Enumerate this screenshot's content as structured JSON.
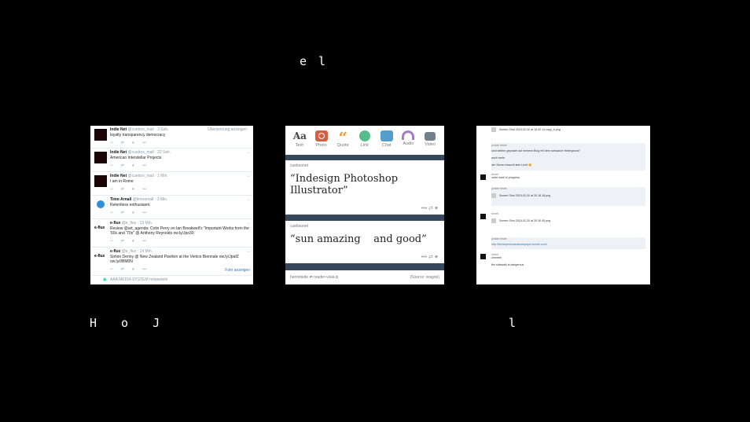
{
  "overlay": {
    "top": "e l",
    "bottom_left": "H o J",
    "bottom_right": "l"
  },
  "twitter": {
    "follow_label": "Übersetzung anzeigen",
    "actions": "↩ ⇄ ★ •••",
    "tweets": [
      {
        "name": "Indie Net",
        "handle": "@cuebox_mail · 3 Sek.",
        "text": "loyalty transparency democracy"
      },
      {
        "name": "Indie Net",
        "handle": "@cuebox_mail · 22 Sek.",
        "text": "American Interstellar Projects"
      },
      {
        "name": "Indie Net",
        "handle": "@cuebox_mail · 1 Min.",
        "text": "I am in Rome"
      },
      {
        "name": "Timo Arnall",
        "handle": "@timoarnall · 3 Min.",
        "text": "Relentless enthusiasm."
      },
      {
        "name": "e-flux",
        "handle": "@e_flux · 13 Min.",
        "text": "Review @art_agenda: Colin Perry on Ian Breakwell's \"Important Works from the '60s and '70s\" @ Anthony Reynolds ow.ly/Jpo30",
        "avatar": "e-flux"
      },
      {
        "name": "e-flux",
        "handle": "@e_flux · 14 Min.",
        "text": "Simon Denny @ New Zealand Pavilion at the Venice Biennale ow.ly/JpafZ ow.ly/i/BM0N",
        "avatar": "e-flux",
        "more": "Foto anzeigen"
      },
      {
        "name": "AAA MEDIA SYSTEM retweetete",
        "handle": "",
        "text": ""
      }
    ]
  },
  "tumblr": {
    "types": [
      {
        "label": "Text",
        "icon": "text-icon",
        "color": "#444444",
        "glyph": "Aa"
      },
      {
        "label": "Photo",
        "icon": "photo-icon",
        "color": "#d95e40",
        "glyph": ""
      },
      {
        "label": "Quote",
        "icon": "quote-icon",
        "color": "#f2992e",
        "glyph": "❝"
      },
      {
        "label": "Link",
        "icon": "link-icon",
        "color": "#56bc8a",
        "glyph": ""
      },
      {
        "label": "Chat",
        "icon": "chat-icon",
        "color": "#529ecc",
        "glyph": ""
      },
      {
        "label": "Audio",
        "icon": "audio-icon",
        "color": "#a77dc2",
        "glyph": ""
      },
      {
        "label": "Video",
        "icon": "video-icon",
        "color": "#748089",
        "glyph": ""
      }
    ],
    "posts": [
      {
        "user": "cuebsonet",
        "quote": "“Indesign Photoshop Illustrator”"
      },
      {
        "user": "cuebsonet",
        "quote": "“sun amazing    and good”"
      }
    ],
    "post_actions": "••• ⇄ ♥",
    "footer_left": "hermitside ⇄ reader-viola ◘",
    "footer_right": "(Source: reagrei)"
  },
  "chat": {
    "messages": [
      {
        "name": "",
        "text": "Screen Shot 2015-02-20 at 15.42.14 copy_b.png",
        "type": "file"
      },
      {
        "name": "jordan fesler",
        "text": "sind seither gepostet auf meinem Blog mit dem schwarze Hintergrund?",
        "type": "text"
      },
      {
        "name": "",
        "text": "noch mehr",
        "type": "text"
      },
      {
        "name": "",
        "text": "der Server braucht kein Licht 😊",
        "type": "text"
      },
      {
        "name": "tomet",
        "text": "order work in progress",
        "type": "text"
      },
      {
        "name": "jordan fesler",
        "text": "Screen Shot 2015-02-20 at 20.16.18.png",
        "type": "file"
      },
      {
        "name": "tomet",
        "text": "Screen Shot 2015-02-20 at 20.30.45.png",
        "type": "file"
      },
      {
        "name": "jordan fesler",
        "text": "http://thedoperlosnewbookpaper.tumblr.com/",
        "type": "link"
      },
      {
        "name": "tomet",
        "text": "uhmeee",
        "type": "text"
      },
      {
        "name": "",
        "text": "the sidewalk is dangerous",
        "type": "text"
      }
    ]
  }
}
